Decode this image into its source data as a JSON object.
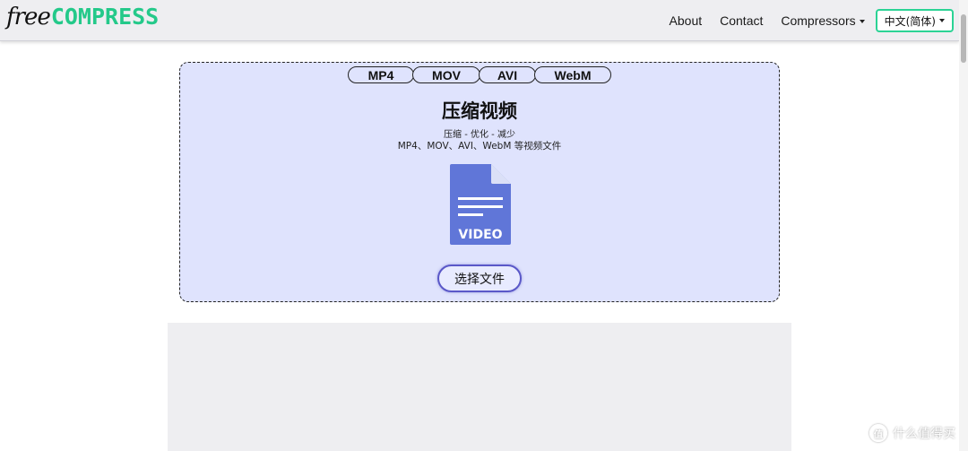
{
  "brand": {
    "logo_free": "free",
    "logo_compress": "COMPRESS",
    "accent": "#24c98a"
  },
  "nav": {
    "about": "About",
    "contact": "Contact",
    "compressors": "Compressors",
    "language": "中文(简体)"
  },
  "formats": [
    "MP4",
    "MOV",
    "AVI",
    "WebM"
  ],
  "upload": {
    "title": "压缩视频",
    "subtitle": "压缩 - 优化 - 减少",
    "description": "MP4、MOV、AVI、WebM 等视频文件",
    "file_icon_label": "VIDEO",
    "select_button": "选择文件",
    "icon_color": "#6076d8",
    "background": "#dfe3fd"
  },
  "watermark": {
    "symbol": "值",
    "text": "什么值得买"
  }
}
